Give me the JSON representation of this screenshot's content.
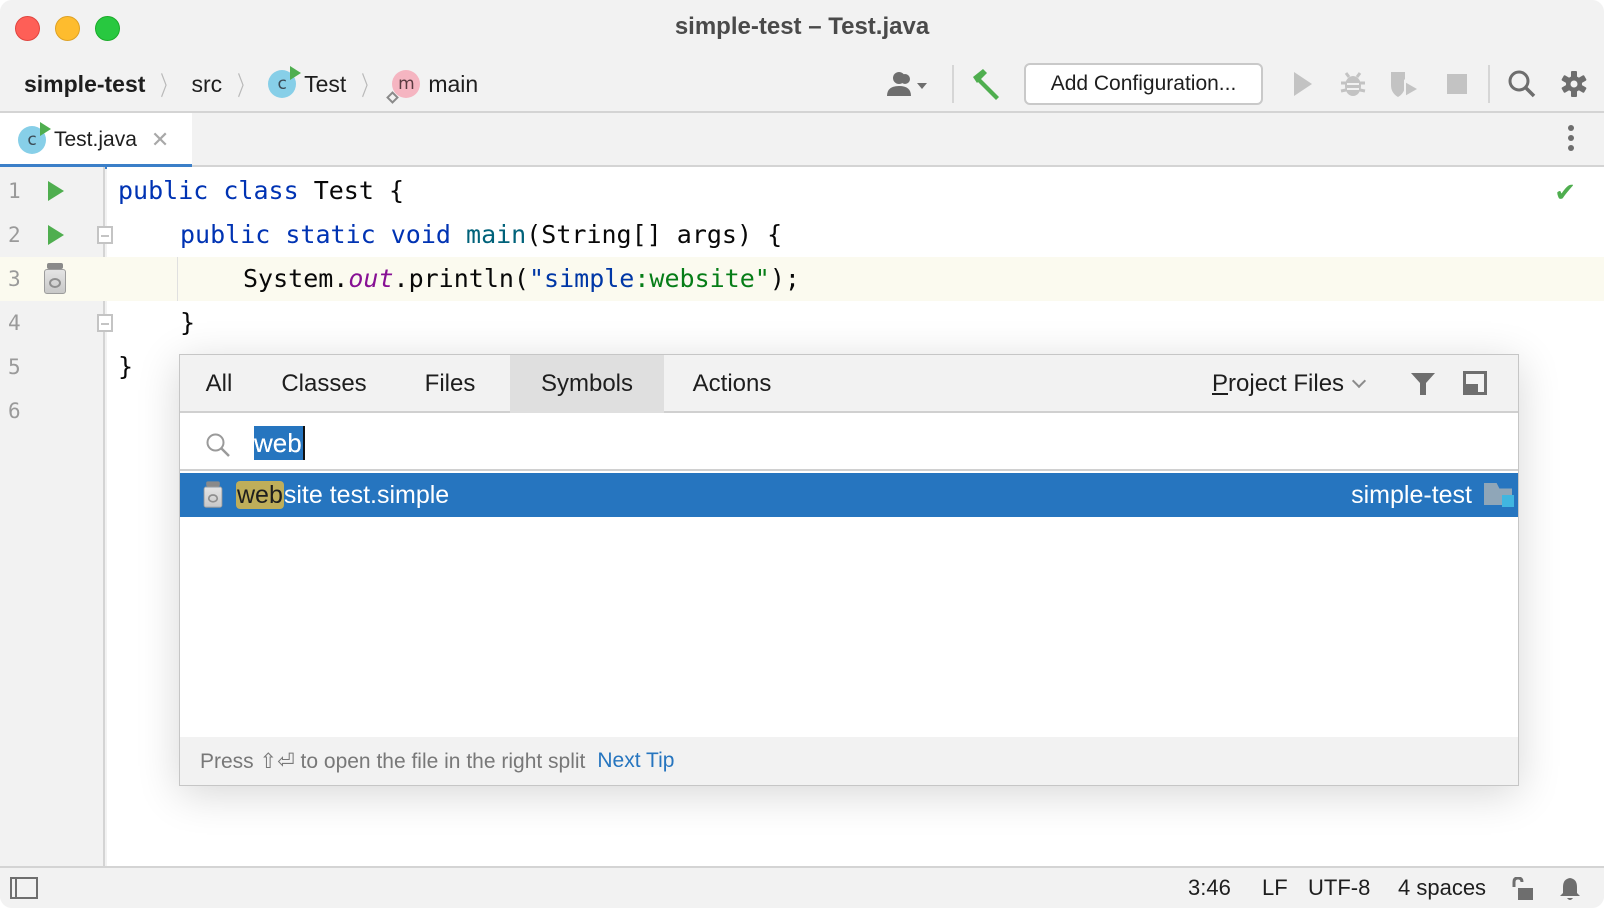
{
  "window": {
    "title": "simple-test – Test.java"
  },
  "breadcrumbs": [
    {
      "label": "simple-test",
      "kind": "project"
    },
    {
      "label": "src",
      "kind": "folder"
    },
    {
      "label": "Test",
      "kind": "class"
    },
    {
      "label": "main",
      "kind": "method"
    }
  ],
  "toolbar": {
    "vcs_icon": "user-dropdown-icon",
    "build_icon": "hammer-icon",
    "add_configuration_label": "Add Configuration...",
    "run_icon": "run-icon",
    "debug_icon": "bug-icon",
    "coverage_icon": "coverage-icon",
    "stop_icon": "stop-icon",
    "search_icon": "search-icon",
    "settings_icon": "gear-icon"
  },
  "editor_tabs": [
    {
      "label": "Test.java",
      "active": true
    }
  ],
  "class_icon_letter": "c",
  "method_icon_letter": "m",
  "editor": {
    "line_numbers": [
      "1",
      "2",
      "3",
      "4",
      "5",
      "6"
    ],
    "current_line": 3,
    "inspection_status": "ok",
    "code": {
      "l1_kw1": "public",
      "l1_kw2": "class",
      "l1_rest": " Test {",
      "l2_kw1": "public",
      "l2_kw2": "static",
      "l2_kw3": "void",
      "l2_fn": "main",
      "l2_rest": "(String[] args) {",
      "l3_obj": "System.",
      "l3_field": "out",
      "l3_call": ".println(",
      "l3_str_q1": "\"",
      "l3_str_a": "simple",
      "l3_str_b": ":website",
      "l3_str_q2": "\"",
      "l3_end": ");",
      "l4": "}",
      "l5": "}"
    }
  },
  "search_popup": {
    "tabs": [
      {
        "label": "All",
        "active": false
      },
      {
        "label": "Classes",
        "active": false
      },
      {
        "label": "Files",
        "active": false
      },
      {
        "label": "Symbols",
        "active": true
      },
      {
        "label": "Actions",
        "active": false
      }
    ],
    "scope_mnemonic": "P",
    "scope_rest": "roject Files",
    "query": "web",
    "results": [
      {
        "match": "web",
        "rest": "site test.simple",
        "module": "simple-test",
        "selected": true
      }
    ],
    "footer_tip": "Press ⇧⏎ to open the file in the right split",
    "next_tip_label": "Next Tip"
  },
  "status_bar": {
    "caret_position": "3:46",
    "line_separator": "LF",
    "encoding": "UTF-8",
    "indent": "4 spaces"
  },
  "colors": {
    "accent": "#2675bf",
    "run_green": "#4fae4f",
    "keyword": "#0033b3",
    "string": "#067d17",
    "match_highlight": "#bfae5a"
  }
}
